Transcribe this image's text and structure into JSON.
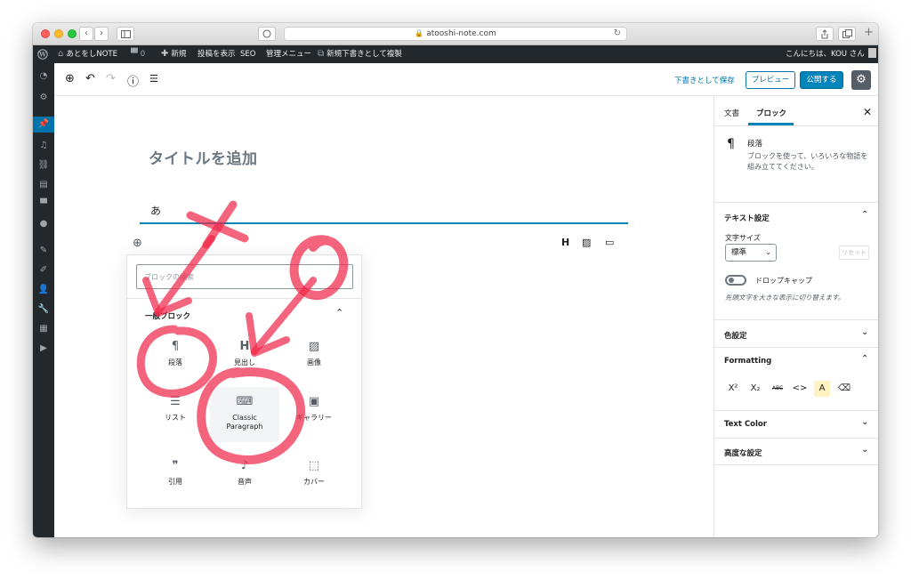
{
  "browser": {
    "url": "atooshi-note.com",
    "nav_back": "‹",
    "nav_forward": "›"
  },
  "adminbar": {
    "site_name": "あとをしNOTE",
    "comments_count": "0",
    "new_label": "新規",
    "view_post": "投稿を表示",
    "seo": "SEO",
    "admin_menu": "管理メニュー",
    "duplicate": "新規下書きとして複製",
    "greeting": "こんにちは、KOU さん"
  },
  "toolbar": {
    "save_draft": "下書きとして保存",
    "preview": "プレビュー",
    "publish": "公開する"
  },
  "canvas": {
    "title_placeholder": "タイトルを追加",
    "paragraph_text": "あ",
    "block_tools": [
      "H",
      "▨",
      "▭"
    ]
  },
  "inserter": {
    "search_placeholder": "ブロックの検索",
    "panel_title": "一般ブロック",
    "blocks": [
      {
        "label": "段落",
        "icon": "¶"
      },
      {
        "label": "見出し",
        "icon": "H"
      },
      {
        "label": "画像",
        "icon": "▨"
      },
      {
        "label": "リスト",
        "icon": "☰"
      },
      {
        "label": "Classic\nParagraph",
        "icon": "⌨"
      },
      {
        "label": "ギャラリー",
        "icon": "▣"
      },
      {
        "label": "引用",
        "icon": "❞"
      },
      {
        "label": "音声",
        "icon": "♪"
      },
      {
        "label": "カバー",
        "icon": "⬚"
      }
    ]
  },
  "sidebar": {
    "tab_document": "文書",
    "tab_block": "ブロック",
    "block_name": "段落",
    "block_desc": "ブロックを使って、いろいろな物語を組み立ててください。",
    "text_settings": "テキスト設定",
    "font_size_label": "文字サイズ",
    "font_size_value": "標準",
    "reset": "リセット",
    "drop_cap": "ドロップキャップ",
    "drop_cap_help": "先頭文字を大きな表示に切り替えます。",
    "color_settings": "色設定",
    "formatting": "Formatting",
    "format_buttons": [
      "X²",
      "X₂",
      "ABC",
      "<>",
      "A",
      "⌫"
    ],
    "text_color": "Text Color",
    "advanced": "高度な設定"
  },
  "colors": {
    "accent": "#0085ba",
    "annotation": "#f0284a"
  }
}
